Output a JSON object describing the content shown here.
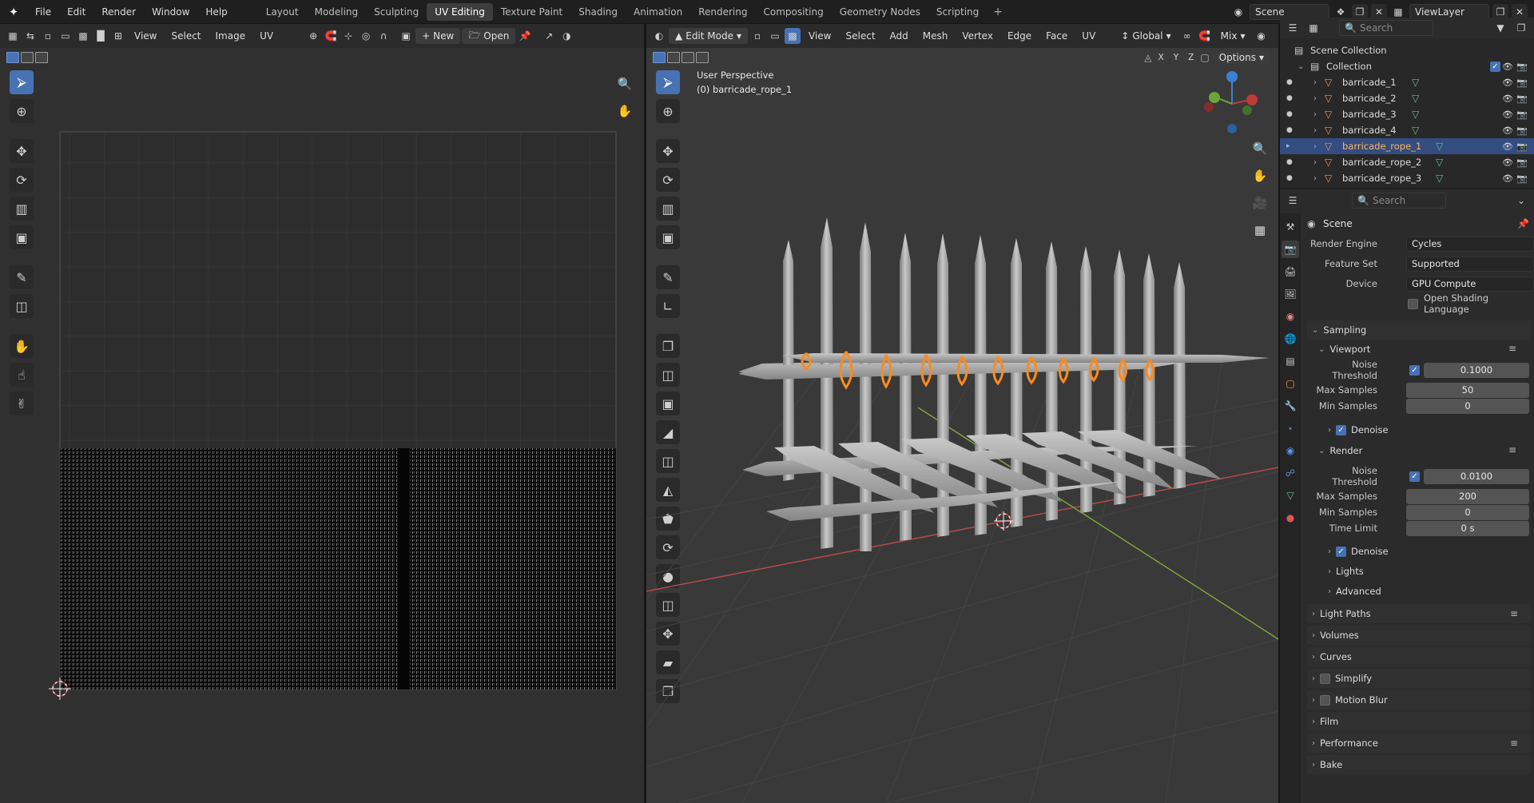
{
  "topbar": {
    "menus": [
      "File",
      "Edit",
      "Render",
      "Window",
      "Help"
    ],
    "workspaces": [
      "Layout",
      "Modeling",
      "Sculpting",
      "UV Editing",
      "Texture Paint",
      "Shading",
      "Animation",
      "Rendering",
      "Compositing",
      "Geometry Nodes",
      "Scripting"
    ],
    "active_workspace": "UV Editing",
    "scene": "Scene",
    "view_layer": "ViewLayer"
  },
  "uv_editor": {
    "menus": [
      "View",
      "Select",
      "Image",
      "UV"
    ],
    "new_label": "New",
    "open_label": "Open"
  },
  "viewport": {
    "mode": "Edit Mode",
    "menus": [
      "View",
      "Select",
      "Add",
      "Mesh",
      "Vertex",
      "Edge",
      "Face",
      "UV"
    ],
    "orientation": "Global",
    "blend": "Mix",
    "options_label": "Options",
    "axes": [
      "X",
      "Y",
      "Z"
    ],
    "overlay_line1": "User Perspective",
    "overlay_line2": "(0) barricade_rope_1"
  },
  "outliner": {
    "search_placeholder": "Search",
    "scene_collection": "Scene Collection",
    "collection": "Collection",
    "objects": [
      "barricade_1",
      "barricade_2",
      "barricade_3",
      "barricade_4",
      "barricade_rope_1",
      "barricade_rope_2",
      "barricade_rope_3"
    ],
    "selected": "barricade_rope_1"
  },
  "properties": {
    "search_placeholder": "Search",
    "context": "Scene",
    "render_engine_label": "Render Engine",
    "render_engine": "Cycles",
    "feature_set_label": "Feature Set",
    "feature_set": "Supported",
    "device_label": "Device",
    "device": "GPU Compute",
    "osl_label": "Open Shading Language",
    "sampling": "Sampling",
    "viewport": "Viewport",
    "noise_threshold_label": "Noise Threshold",
    "vp_noise_threshold": "0.1000",
    "max_samples_label": "Max Samples",
    "vp_max_samples": "50",
    "min_samples_label": "Min Samples",
    "vp_min_samples": "0",
    "denoise_label": "Denoise",
    "render": "Render",
    "r_noise_threshold": "0.0100",
    "r_max_samples": "200",
    "r_min_samples": "0",
    "time_limit_label": "Time Limit",
    "r_time_limit": "0 s",
    "lights": "Lights",
    "advanced": "Advanced",
    "panels": [
      "Light Paths",
      "Volumes",
      "Curves",
      "Simplify",
      "Motion Blur",
      "Film",
      "Performance",
      "Bake"
    ]
  }
}
